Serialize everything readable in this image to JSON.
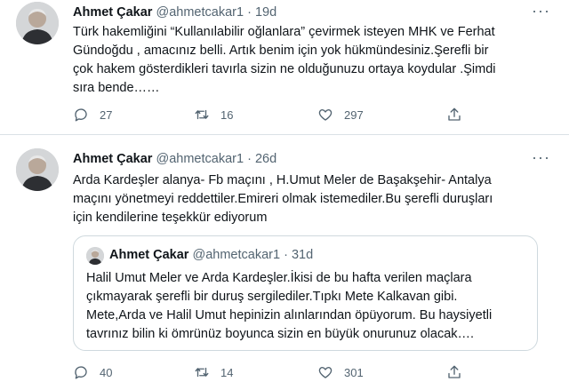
{
  "tweets": [
    {
      "author_name": "Ahmet Çakar",
      "handle": "@ahmetcakar1",
      "separator": "·",
      "time": "19d",
      "lines": [
        "Türk hakemliğini “Kullanılabilir oğlanlara” çevirmek isteyen MHK ve Ferhat",
        "Gündoğdu , amacınız belli. Artık benim için yok hükmündesiniz.Şerefli bir",
        "çok hakem gösterdikleri tavırla sizin ne olduğunuzu ortaya koydular .Şimdi",
        "sıra bende……"
      ],
      "replies": "27",
      "retweets": "16",
      "likes": "297"
    },
    {
      "author_name": "Ahmet Çakar",
      "handle": "@ahmetcakar1",
      "separator": "·",
      "time": "26d",
      "lines": [
        "Arda Kardeşler alanya- Fb maçını , H.Umut Meler de Başakşehir- Antalya",
        "maçını yönetmeyi reddettiler.Emireri olmak istemediler.Bu şerefli duruşları",
        "için kendilerine teşekkür ediyorum"
      ],
      "quoted": {
        "author_name": "Ahmet Çakar",
        "handle": "@ahmetcakar1",
        "separator": "·",
        "time": "31d",
        "lines": [
          "Halil Umut Meler ve Arda Kardeşler.İkisi de bu hafta verilen maçlara",
          "çıkmayarak şerefli bir duruş sergilediler.Tıpkı Mete Kalkavan gibi.",
          "Mete,Arda ve Halil Umut hepinizin alınlarından öpüyorum. Bu haysiyetli",
          "tavrınız bilin ki ömrünüz boyunca sizin en büyük onurunuz olacak…."
        ]
      },
      "replies": "40",
      "retweets": "14",
      "likes": "301"
    }
  ],
  "icons": {
    "more": "more-horizontal-icon",
    "reply": "reply-icon",
    "retweet": "retweet-icon",
    "like": "heart-icon",
    "share": "share-icon"
  },
  "colors": {
    "text": "#0f1419",
    "secondary": "#536471",
    "border": "#cfd9de"
  }
}
